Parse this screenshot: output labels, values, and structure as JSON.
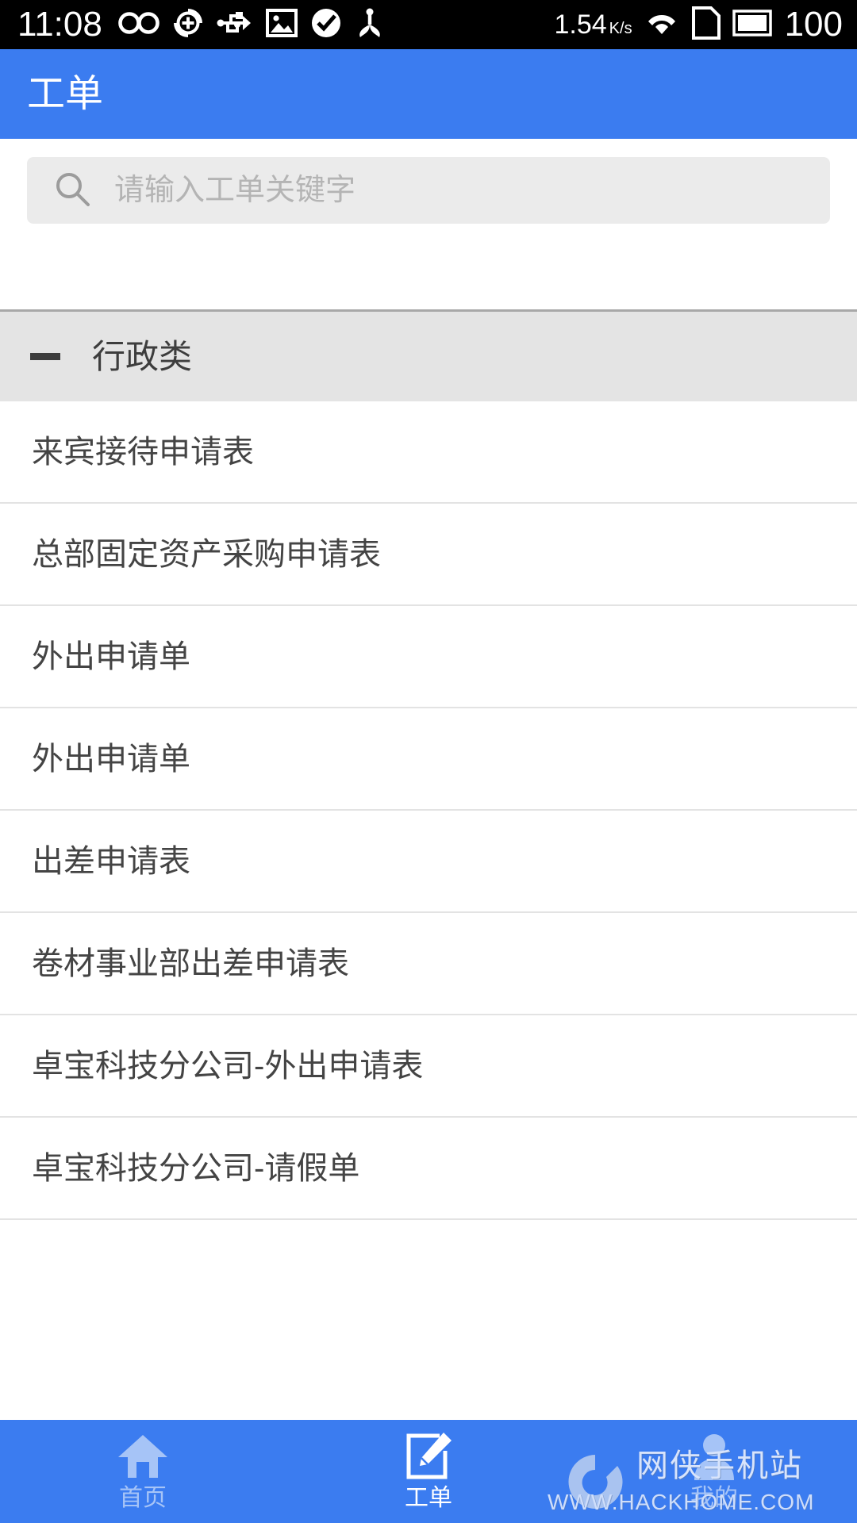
{
  "status_bar": {
    "clock": "11:08",
    "net_speed_value": "1.54",
    "net_speed_unit": "K/s",
    "battery_percent": "100",
    "icons": [
      "infinity-icon",
      "sync-add-icon",
      "usb-icon",
      "image-icon",
      "check-circle-icon",
      "bluetooth-share-icon",
      "wifi-icon",
      "sim-card-icon",
      "battery-icon"
    ]
  },
  "app_bar": {
    "title": "工单"
  },
  "search": {
    "placeholder": "请输入工单关键字",
    "value": "",
    "icon": "search-icon"
  },
  "list": {
    "group": {
      "title": "行政类",
      "collapse_icon": "minus-icon",
      "expanded": true
    },
    "items": [
      {
        "label": "来宾接待申请表"
      },
      {
        "label": "总部固定资产采购申请表"
      },
      {
        "label": "外出申请单"
      },
      {
        "label": "外出申请单"
      },
      {
        "label": "出差申请表"
      },
      {
        "label": "卷材事业部出差申请表"
      },
      {
        "label": "卓宝科技分公司-外出申请表"
      },
      {
        "label": "卓宝科技分公司-请假单"
      }
    ]
  },
  "bottom_nav": {
    "items": [
      {
        "label": "首页",
        "icon": "home-icon",
        "active": false
      },
      {
        "label": "工单",
        "icon": "edit-document-icon",
        "active": true
      },
      {
        "label": "我的",
        "icon": "person-icon",
        "active": false
      }
    ]
  },
  "watermark": {
    "site_cn": "网侠手机站",
    "site_url": "WWW.HACKHOME.COM"
  },
  "colors": {
    "brand_blue": "#3b7cf0",
    "status_bar_bg": "#000000",
    "group_header_bg": "#e4e4e4",
    "search_field_bg": "#ebebeb",
    "divider": "#e3e3e3",
    "text_primary": "#444444",
    "text_placeholder": "#b4b4b4",
    "nav_inactive": "#a6c4f7"
  }
}
